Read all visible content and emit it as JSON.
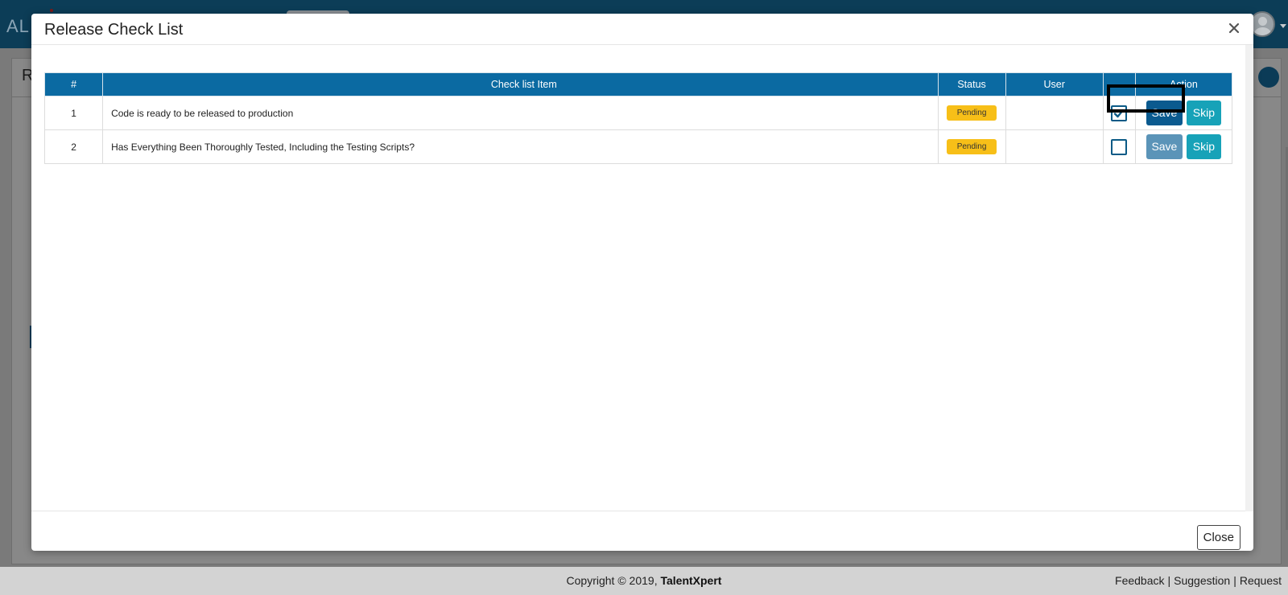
{
  "app": {
    "logo_text": "AL",
    "page_letter": "R"
  },
  "modal": {
    "title": "Release Check List",
    "close_label": "Close",
    "table": {
      "headers": {
        "num": "#",
        "item": "Check list Item",
        "status": "Status",
        "user": "User",
        "check": "",
        "action": "Action"
      },
      "rows": [
        {
          "num": "1",
          "item": "Code is ready to be released to production",
          "status": "Pending",
          "user": "",
          "checked": true,
          "save_label": "Save",
          "skip_label": "Skip"
        },
        {
          "num": "2",
          "item": "Has Everything Been Thoroughly Tested, Including the Testing Scripts?",
          "status": "Pending",
          "user": "",
          "checked": false,
          "save_label": "Save",
          "skip_label": "Skip"
        }
      ]
    }
  },
  "footer": {
    "copyright_prefix": "Copyright © 2019,",
    "brand": "TalentXpert",
    "links": [
      "Feedback",
      "Suggestion",
      "Request"
    ]
  },
  "colors": {
    "header_blue": "#0b6aa2",
    "topbar": "#0c3d57",
    "pending_badge": "#f7bf18",
    "save_button": "#0b5a8f",
    "save_button_disabled": "#5b94b8",
    "skip_button": "#17a2b8"
  }
}
